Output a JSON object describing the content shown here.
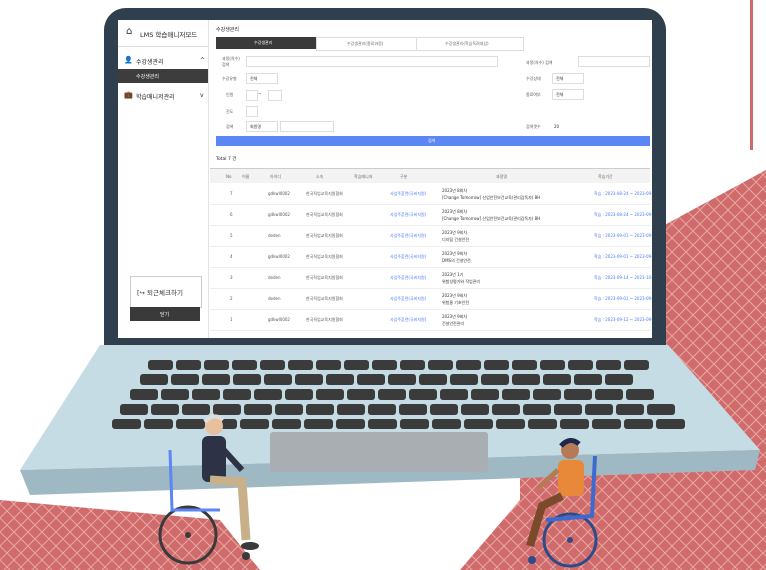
{
  "colors": {
    "laptop_frame": "#2f3f4d",
    "laptop_base": "#c6dce5",
    "keyboard_key": "#3b3b3b",
    "trackpad": "#a9aeb2",
    "pattern": "#cf6b6b",
    "accent_blue": "#5b86f4",
    "dark_button": "#3a3a3a"
  },
  "app": {
    "title": "LMS 학습매니저모드",
    "home_icon": "home-icon",
    "page_title": "수강생관리",
    "tabs": [
      {
        "label": "수강생관리"
      },
      {
        "label": "수강생관리(종료과정)"
      },
      {
        "label": "수강생관리(학습독려대상)"
      }
    ],
    "sidebar": {
      "menu1": {
        "label": "수강생관리",
        "icon": "user-icon",
        "chevron": "^"
      },
      "sub1": "수강생관리",
      "menu2": {
        "label": "학습매니저관리",
        "icon": "briefcase-icon",
        "chevron": "v"
      },
      "checkin_button": "[↪ 퇴근체크하기",
      "close_button": "닫기"
    },
    "filters": {
      "course_name_label": "과정(차수)\n검색",
      "course_name2_label": "과정(차수) 검색",
      "type_label": "수강유형",
      "type_value": "전체",
      "personnel_label": "인원",
      "dash": "~",
      "progress_label": "진도",
      "search_label": "검색",
      "search_select": "회원명",
      "status_label": "수강상태",
      "status_value": "전체",
      "complete_label": "종료여부",
      "complete_value": "전체",
      "page_count_label": "검색갯수",
      "page_count_value": "20",
      "search_button": "검색"
    },
    "total": "Total 7 건",
    "table": {
      "headers": [
        "No",
        "이름",
        "아이디",
        "소속",
        "학습매니저",
        "구분",
        "과정명",
        "학습기간"
      ],
      "rows": [
        {
          "no": "7",
          "id": "gdkwl0002",
          "org": "한국직업교육지원협회",
          "type": "사업주훈련(국비지원)",
          "title1": "2023년 8회차",
          "title2": "[Change Tomorrow] 산업안전보건교육(관리감독자) 8H",
          "period": "학습 : 2023-08-24 ~ 2023-09-30"
        },
        {
          "no": "6",
          "id": "gdkwl0002",
          "org": "한국직업교육지원협회",
          "type": "사업주훈련(국비지원)",
          "title1": "2023년 8회차",
          "title2": "[Change Tomorrow] 산업안전보건교육(관리감독자) 8H",
          "period": "학습 : 2023-08-24 ~ 2023-09-30"
        },
        {
          "no": "5",
          "id": "deden",
          "org": "한국직업교육지원협회",
          "type": "사업주훈련(국비지원)",
          "title1": "2023년 9회차",
          "title2": "디지털 건설안전",
          "period": "학습 : 2023-09-01 ~ 2023-09-30"
        },
        {
          "no": "4",
          "id": "gdkwl0002",
          "org": "한국직업교육지원협회",
          "type": "사업주훈련(국비지원)",
          "title1": "2023년 9회차",
          "title2": "DMS의 건설안전",
          "period": "학습 : 2023-09-01 ~ 2023-09-30"
        },
        {
          "no": "3",
          "id": "deden",
          "org": "한국직업교육지원협회",
          "type": "사업주훈련(국비지원)",
          "title1": "2023년 1기",
          "title2": "위험성평가와 작업관리",
          "period": "학습 : 2023-09-14 ~ 2023-10-30"
        },
        {
          "no": "2",
          "id": "deden",
          "org": "한국직업교육지원협회",
          "type": "사업주훈련(국비지원)",
          "title1": "2023년 9회차",
          "title2": "위험물 기초안전",
          "period": "학습 : 2023-09-01 ~ 2023-09-30"
        },
        {
          "no": "1",
          "id": "gdkwl0002",
          "org": "한국직업교육지원협회",
          "type": "사업주훈련(국비지원)",
          "title1": "2023년 9회차",
          "title2": "건설안전관리",
          "period": "학습 : 2023-09-12 ~ 2023-09-30"
        }
      ]
    }
  }
}
